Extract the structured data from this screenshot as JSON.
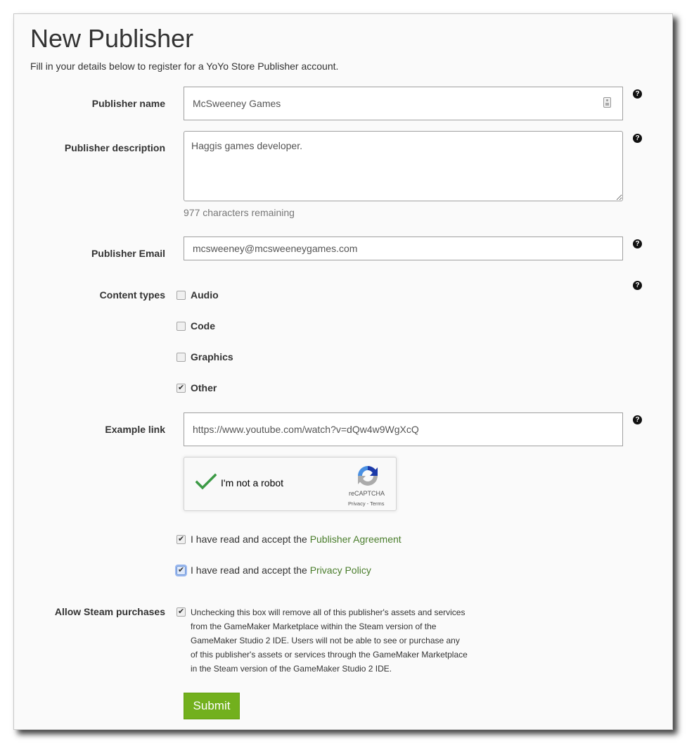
{
  "page": {
    "title": "New Publisher",
    "subtitle": "Fill in your details below to register for a YoYo Store Publisher account."
  },
  "form": {
    "publisher_name": {
      "label": "Publisher name",
      "value": "McSweeney Games"
    },
    "publisher_description": {
      "label": "Publisher description",
      "value": "Haggis games developer.",
      "chars_remaining": "977 characters remaining"
    },
    "publisher_email": {
      "label": "Publisher Email",
      "value": "mcsweeney@mcsweeneygames.com"
    },
    "content_types": {
      "label": "Content types",
      "options": [
        {
          "label": "Audio",
          "checked": false
        },
        {
          "label": "Code",
          "checked": false
        },
        {
          "label": "Graphics",
          "checked": false
        },
        {
          "label": "Other",
          "checked": true
        }
      ]
    },
    "example_link": {
      "label": "Example link",
      "value": "https://www.youtube.com/watch?v=dQw4w9WgXcQ"
    },
    "captcha": {
      "text": "I'm not a robot",
      "brand": "reCAPTCHA",
      "links": "Privacy - Terms",
      "verified": true,
      "check_color": "#3c9a46"
    },
    "agreements": [
      {
        "prefix": "I have read and accept the ",
        "link": "Publisher Agreement",
        "checked": true
      },
      {
        "prefix": "I have read and accept the ",
        "link": "Privacy Policy",
        "checked": true
      }
    ],
    "steam": {
      "label": "Allow Steam purchases",
      "checked": true,
      "description": "Unchecking this box will remove all of this publisher's assets and services from the GameMaker Marketplace within the Steam version of the GameMaker Studio 2 IDE. Users will not be able to see or purchase any of this publisher's assets or services through the GameMaker Marketplace in the Steam version of the GameMaker Studio 2 IDE."
    },
    "submit_label": "Submit",
    "help_icon_glyph": "?"
  },
  "colors": {
    "accent_green": "#72b01d",
    "link_green": "#4a7d2c"
  }
}
